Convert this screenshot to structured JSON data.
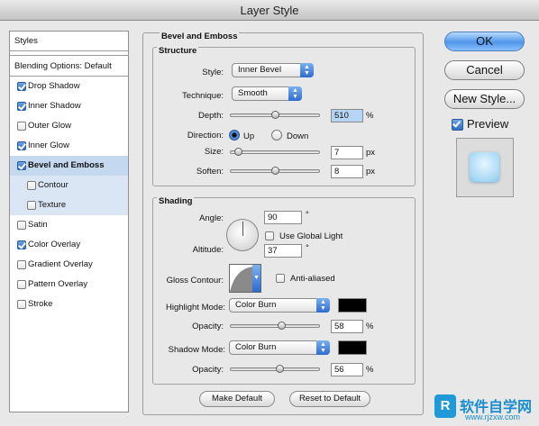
{
  "window": {
    "title": "Layer Style"
  },
  "sidebar": {
    "header": "Styles",
    "blending": "Blending Options: Default",
    "items": [
      {
        "label": "Drop Shadow",
        "checked": true
      },
      {
        "label": "Inner Shadow",
        "checked": true
      },
      {
        "label": "Outer Glow",
        "checked": false
      },
      {
        "label": "Inner Glow",
        "checked": true
      },
      {
        "label": "Bevel and Emboss",
        "checked": true
      },
      {
        "label": "Contour",
        "checked": false
      },
      {
        "label": "Texture",
        "checked": false
      },
      {
        "label": "Satin",
        "checked": false
      },
      {
        "label": "Color Overlay",
        "checked": true
      },
      {
        "label": "Gradient Overlay",
        "checked": false
      },
      {
        "label": "Pattern Overlay",
        "checked": false
      },
      {
        "label": "Stroke",
        "checked": false
      }
    ]
  },
  "panel": {
    "title": "Bevel and Emboss",
    "structure": {
      "title": "Structure",
      "style_label": "Style:",
      "style_value": "Inner Bevel",
      "technique_label": "Technique:",
      "technique_value": "Smooth",
      "depth_label": "Depth:",
      "depth_value": "510",
      "depth_unit": "%",
      "depth_slider": 0.5,
      "direction_label": "Direction:",
      "up_label": "Up",
      "down_label": "Down",
      "direction": "Up",
      "size_label": "Size:",
      "size_value": "7",
      "size_unit": "px",
      "size_slider": 0.05,
      "soften_label": "Soften:",
      "soften_value": "8",
      "soften_unit": "px",
      "soften_slider": 0.5
    },
    "shading": {
      "title": "Shading",
      "angle_label": "Angle:",
      "angle_value": "90",
      "angle_unit": "°",
      "global_light_label": "Use Global Light",
      "global_light": false,
      "altitude_label": "Altitude:",
      "altitude_value": "37",
      "altitude_unit": "°",
      "gloss_label": "Gloss Contour:",
      "antialiased_label": "Anti-aliased",
      "antialiased": false,
      "highlight_label": "Highlight Mode:",
      "highlight_mode": "Color Burn",
      "highlight_color": "#000000",
      "highlight_opacity_label": "Opacity:",
      "highlight_opacity": "58",
      "highlight_opacity_unit": "%",
      "shadow_label": "Shadow Mode:",
      "shadow_mode": "Color Burn",
      "shadow_color": "#000000",
      "shadow_opacity_label": "Opacity:",
      "shadow_opacity": "56",
      "shadow_opacity_unit": "%"
    },
    "make_default": "Make Default",
    "reset_default": "Reset to Default"
  },
  "buttons": {
    "ok": "OK",
    "cancel": "Cancel",
    "new_style": "New Style..."
  },
  "preview": {
    "label": "Preview",
    "checked": true
  },
  "watermark": {
    "brand": "软件自学网",
    "url": "www.rjzxw.com"
  },
  "colors": {
    "accent": "#3a7ed8",
    "selection": "#c4d8f0"
  }
}
